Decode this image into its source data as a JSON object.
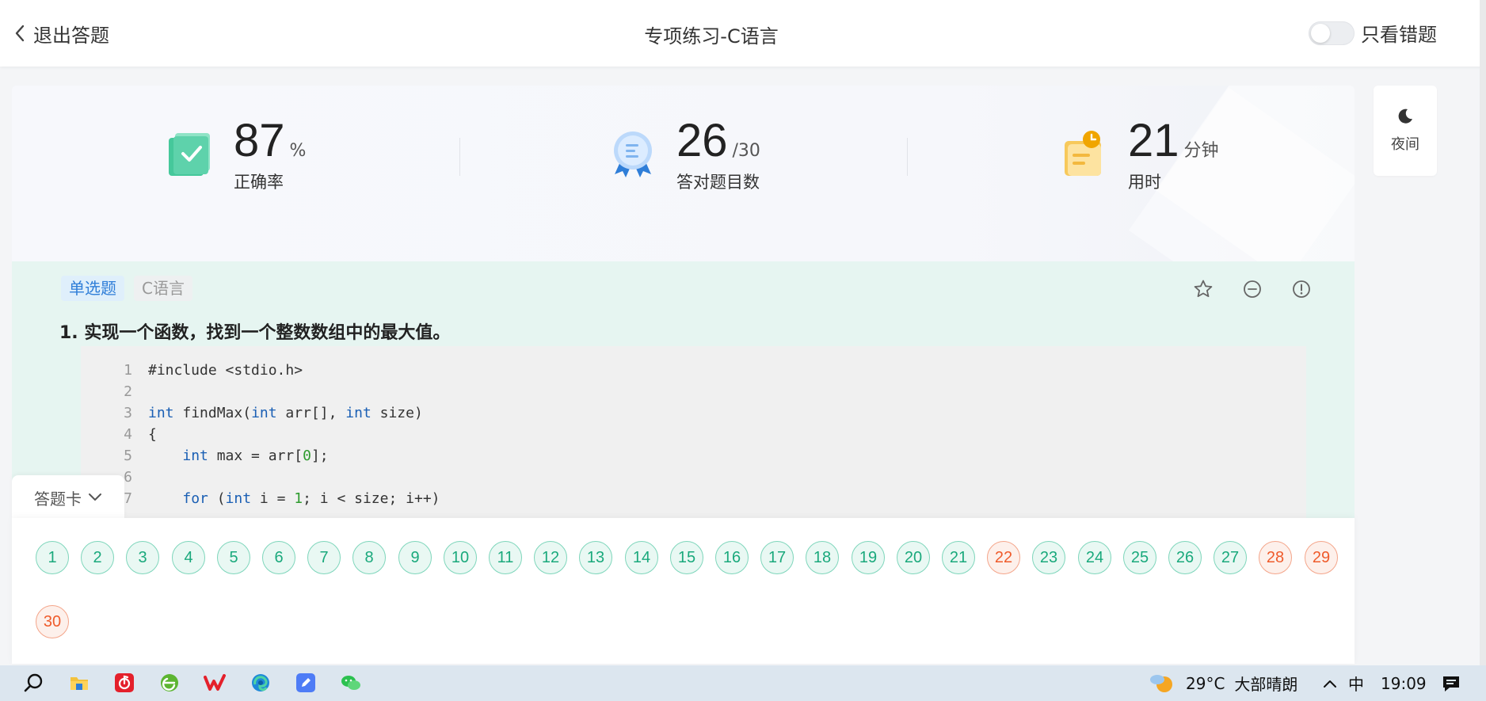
{
  "header": {
    "back_label": "退出答题",
    "title": "专项练习-C语言",
    "wrong_only_label": "只看错题"
  },
  "night_button": {
    "label": "夜间"
  },
  "stats": {
    "accuracy": {
      "value": "87",
      "unit": "%",
      "label": "正确率"
    },
    "correct": {
      "value": "26",
      "unit": "/30",
      "label": "答对题目数"
    },
    "time": {
      "value": "21",
      "unit": "分钟",
      "label": "用时"
    }
  },
  "question": {
    "type_tag": "单选题",
    "lang_tag": "C语言",
    "text": "1. 实现一个函数，找到一个整数数组中的最大值。",
    "code_lines": [
      {
        "n": "1",
        "html": "#include &lt;stdio.h&gt;"
      },
      {
        "n": "2",
        "html": ""
      },
      {
        "n": "3",
        "html": "<span class='kw'>int</span> findMax(<span class='kw'>int</span> arr[], <span class='kw'>int</span> size)"
      },
      {
        "n": "4",
        "html": "{"
      },
      {
        "n": "5",
        "html": "    <span class='kw'>int</span> max = arr[<span class='numlit'>0</span>];"
      },
      {
        "n": "6",
        "html": ""
      },
      {
        "n": "7",
        "html": "    <span class='kw'>for</span> (<span class='kw'>int</span> i = <span class='numlit'>1</span>; i &lt; size; i++)"
      }
    ]
  },
  "answer_card": {
    "tab_label": "答题卡",
    "numbers": [
      {
        "n": "1",
        "wrong": false
      },
      {
        "n": "2",
        "wrong": false
      },
      {
        "n": "3",
        "wrong": false
      },
      {
        "n": "4",
        "wrong": false
      },
      {
        "n": "5",
        "wrong": false
      },
      {
        "n": "6",
        "wrong": false
      },
      {
        "n": "7",
        "wrong": false
      },
      {
        "n": "8",
        "wrong": false
      },
      {
        "n": "9",
        "wrong": false
      },
      {
        "n": "10",
        "wrong": false
      },
      {
        "n": "11",
        "wrong": false
      },
      {
        "n": "12",
        "wrong": false
      },
      {
        "n": "13",
        "wrong": false
      },
      {
        "n": "14",
        "wrong": false
      },
      {
        "n": "15",
        "wrong": false
      },
      {
        "n": "16",
        "wrong": false
      },
      {
        "n": "17",
        "wrong": false
      },
      {
        "n": "18",
        "wrong": false
      },
      {
        "n": "19",
        "wrong": false
      },
      {
        "n": "20",
        "wrong": false
      },
      {
        "n": "21",
        "wrong": false
      },
      {
        "n": "22",
        "wrong": true
      },
      {
        "n": "23",
        "wrong": false
      },
      {
        "n": "24",
        "wrong": false
      },
      {
        "n": "25",
        "wrong": false
      },
      {
        "n": "26",
        "wrong": false
      },
      {
        "n": "27",
        "wrong": false
      },
      {
        "n": "28",
        "wrong": true
      },
      {
        "n": "29",
        "wrong": true
      },
      {
        "n": "30",
        "wrong": true
      }
    ]
  },
  "taskbar": {
    "weather": "29°C",
    "weather_desc": "大部晴朗",
    "ime": "中",
    "time": "19:09"
  },
  "colors": {
    "correct_green": "#1aa97c",
    "wrong_orange": "#ef5b2b",
    "question_bg": "#e6f5f1"
  }
}
